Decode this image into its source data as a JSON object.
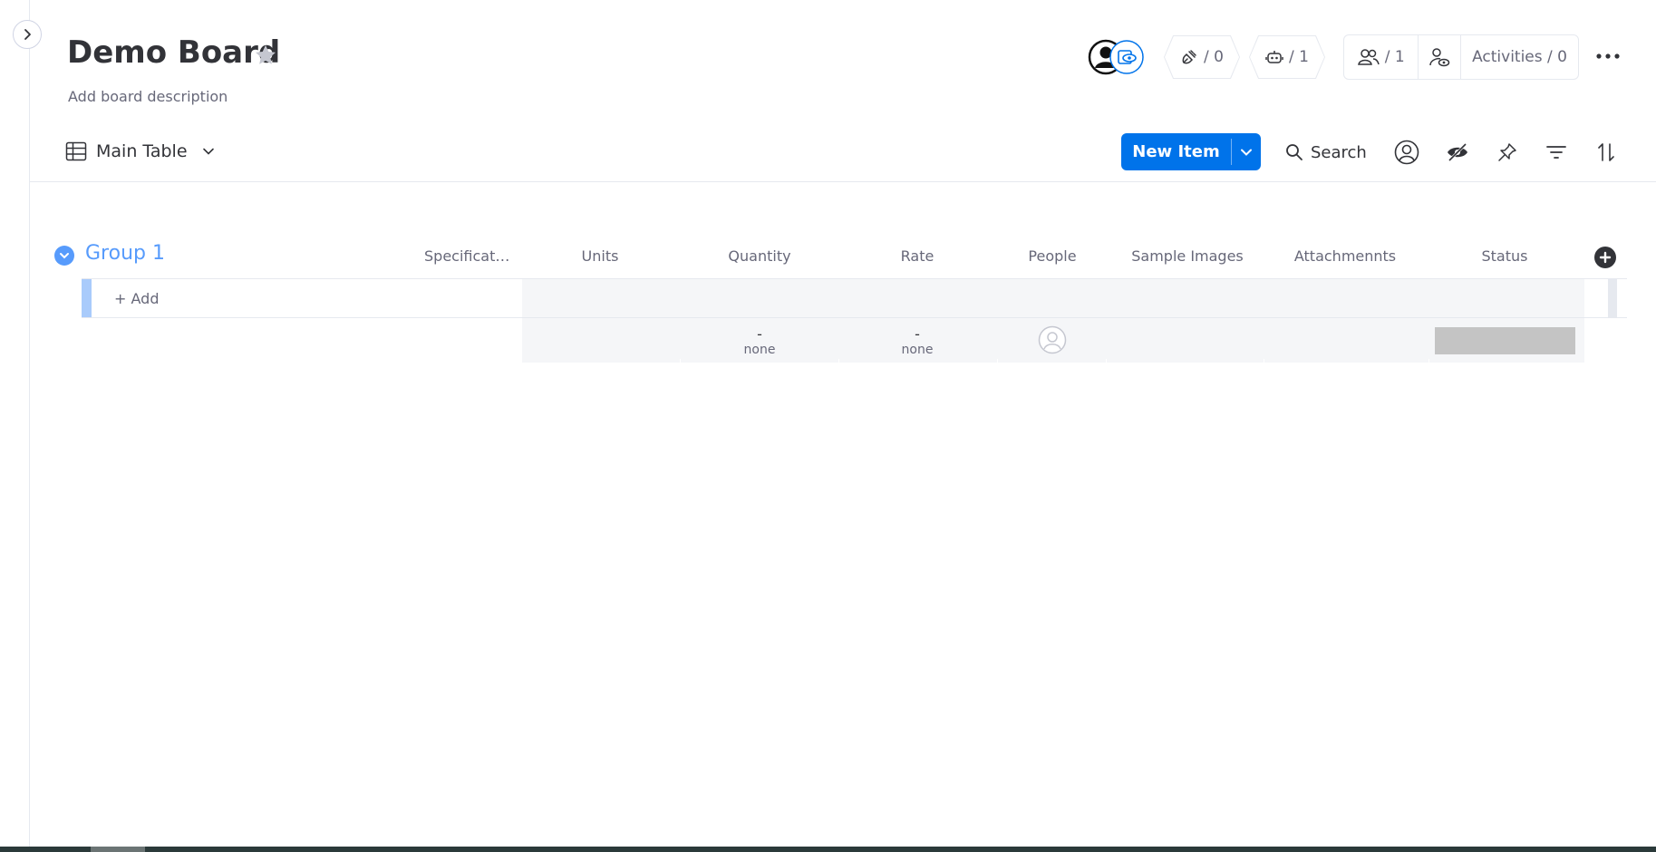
{
  "board": {
    "title": "Demo Board",
    "description": "Add board description"
  },
  "header": {
    "integrations_count": "/ 0",
    "automations_count": "/ 1",
    "members_count": "/ 1",
    "activities_label": "Activities / 0"
  },
  "toolbar": {
    "view_label": "Main Table",
    "new_item_label": "New Item",
    "search_label": "Search"
  },
  "group": {
    "name": "Group 1",
    "color": "#579bfc",
    "add_label": "+ Add"
  },
  "columns": [
    "Specificati...",
    "Units",
    "Quantity",
    "Rate",
    "People",
    "Sample Images",
    "Attachmennts",
    "Status"
  ],
  "summary": {
    "quantity": {
      "value": "-",
      "label": "none"
    },
    "rate": {
      "value": "-",
      "label": "none"
    }
  },
  "colors": {
    "primary": "#0073ea",
    "group": "#579bfc",
    "status_empty": "#c4c4c4"
  }
}
